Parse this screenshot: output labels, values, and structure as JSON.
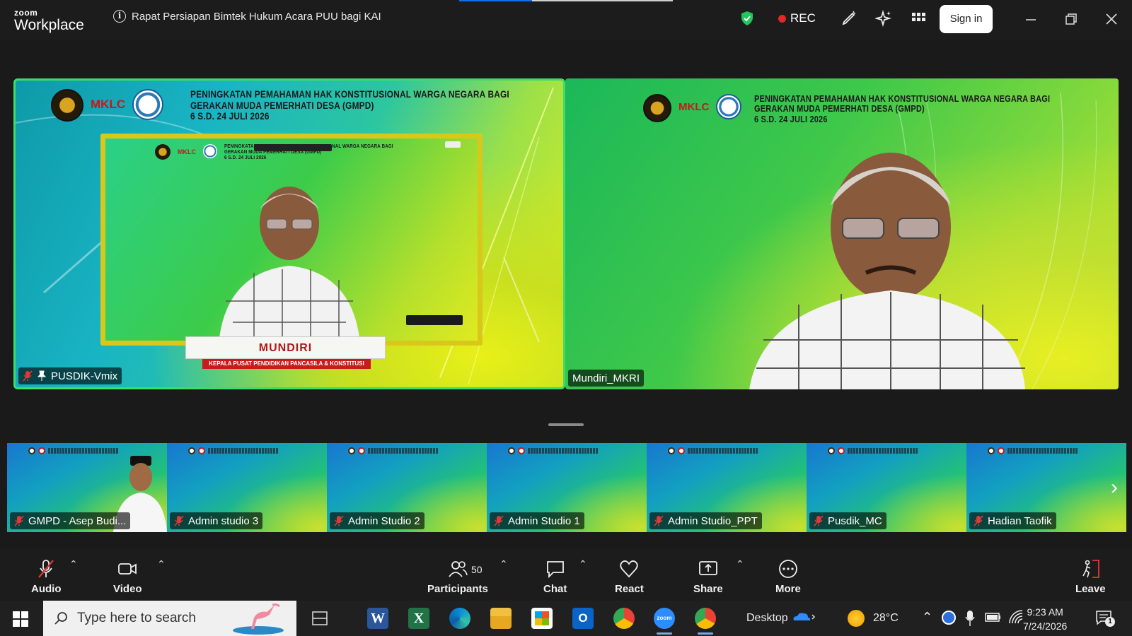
{
  "window": {
    "logo_line1": "zoom",
    "logo_line2": "Workplace",
    "meeting_title": "Rapat Persiapan Bimtek Hukum Acara PUU bagi KAI",
    "rec_label": "REC",
    "signin_label": "Sign in",
    "loading_progress_pct": 34
  },
  "video": {
    "banner_line1": "PENINGKATAN PEMAHAMAN HAK KONSTITUSIONAL WARGA NEGARA BAGI",
    "banner_line2": "GERAKAN MUDA PEMERHATI DESA (GMPD)",
    "banner_line3": "6 S.D. 24 JULI 2026",
    "logo_text": "MKLC",
    "speaker_card_name": "MUNDIRI",
    "speaker_card_title": "KEPALA PUSAT PENDIDIKAN PANCASILA & KONSTITUSI",
    "left_tile_name": "PUSDIK-Vmix",
    "right_tile_name": "Mundiri_MKRI"
  },
  "thumbnails": [
    {
      "name": "GMPD - Asep Budi..."
    },
    {
      "name": "Admin studio 3"
    },
    {
      "name": "Admin Studio 2"
    },
    {
      "name": "Admin Studio 1"
    },
    {
      "name": "Admin Studio_PPT"
    },
    {
      "name": "Pusdik_MC"
    },
    {
      "name": "Hadian Taofik"
    }
  ],
  "controls": {
    "audio": "Audio",
    "video": "Video",
    "participants": "Participants",
    "participants_count": "50",
    "chat": "Chat",
    "react": "React",
    "share": "Share",
    "more": "More",
    "leave": "Leave"
  },
  "taskbar": {
    "search_placeholder": "Type here to search",
    "desktop_label": "Desktop",
    "temperature": "28°C",
    "time": "9:23 AM",
    "date": "7/24/2026",
    "notification_count": "1"
  },
  "colors": {
    "active_speaker_border": "#3ddc6b",
    "rec_dot": "#e02828",
    "progress": "#0e72ed"
  }
}
